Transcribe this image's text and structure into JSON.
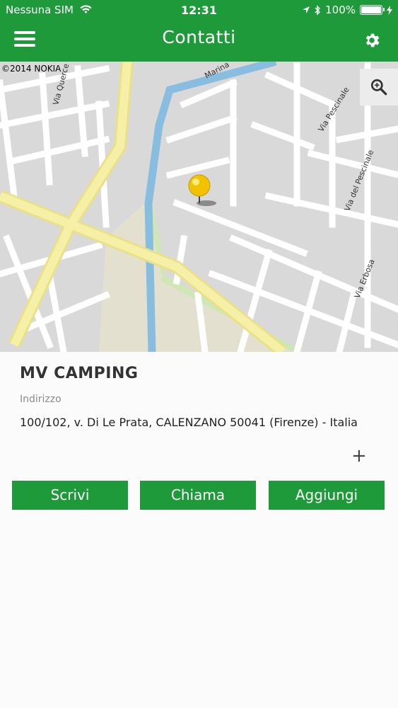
{
  "status_bar": {
    "carrier": "Nessuna SIM",
    "time": "12:31",
    "battery": "100%",
    "battery_level": 1.0
  },
  "header": {
    "title": "Contatti",
    "menu_icon": "menu-icon",
    "settings_icon": "gear-icon"
  },
  "map": {
    "copyright": "©2014 NOKIA",
    "streets": [
      "Via Querce",
      "Marina",
      "Via Pescinale",
      "Via del Pescinale",
      "Via Erbosa"
    ],
    "zoom_icon": "search-icon"
  },
  "place": {
    "name": "MV CAMPING",
    "address_label": "Indirizzo",
    "address": "100/102, v. Di Le Prata, CALENZANO 50041 (Firenze) - Italia",
    "expand_label": "+"
  },
  "actions": {
    "write": "Scrivi",
    "call": "Chiama",
    "add": "Aggiungi"
  },
  "colors": {
    "brand": "#1f9a3a",
    "map_bg": "#d9d9d9",
    "road_major": "#f4ec9c",
    "water": "#89bde0"
  }
}
